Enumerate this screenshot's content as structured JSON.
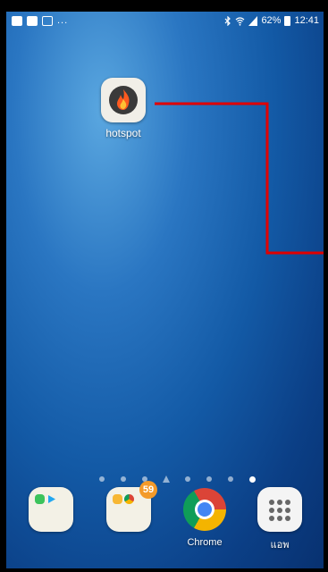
{
  "status_bar": {
    "left_icons": [
      "image-notification-icon",
      "flipboard-notification-icon",
      "gallery-notification-icon"
    ],
    "overflow": "...",
    "right_icons": [
      "bluetooth-icon",
      "wifi-icon",
      "signal-icon"
    ],
    "battery": "62%",
    "time": "12:41"
  },
  "home_screen": {
    "apps": [
      {
        "label": "hotspot",
        "icon": "flame-icon"
      }
    ],
    "page_count": 8,
    "active_page": 8,
    "home_page": 4
  },
  "dock": {
    "items": [
      {
        "label": "",
        "icon": "folder-icon",
        "kind": "folder"
      },
      {
        "label": "",
        "icon": "folder-icon",
        "kind": "folder",
        "badge": "59"
      },
      {
        "label": "Chrome",
        "icon": "chrome-icon"
      },
      {
        "label": "แอพ",
        "icon": "apps-grid-icon"
      }
    ]
  },
  "annotation": {
    "color": "#e00000",
    "shape": "connector-line"
  },
  "colors": {
    "wallpaper_top": "#5aa7e0",
    "wallpaper_bottom": "#083170",
    "badge": "#f39a2a"
  }
}
